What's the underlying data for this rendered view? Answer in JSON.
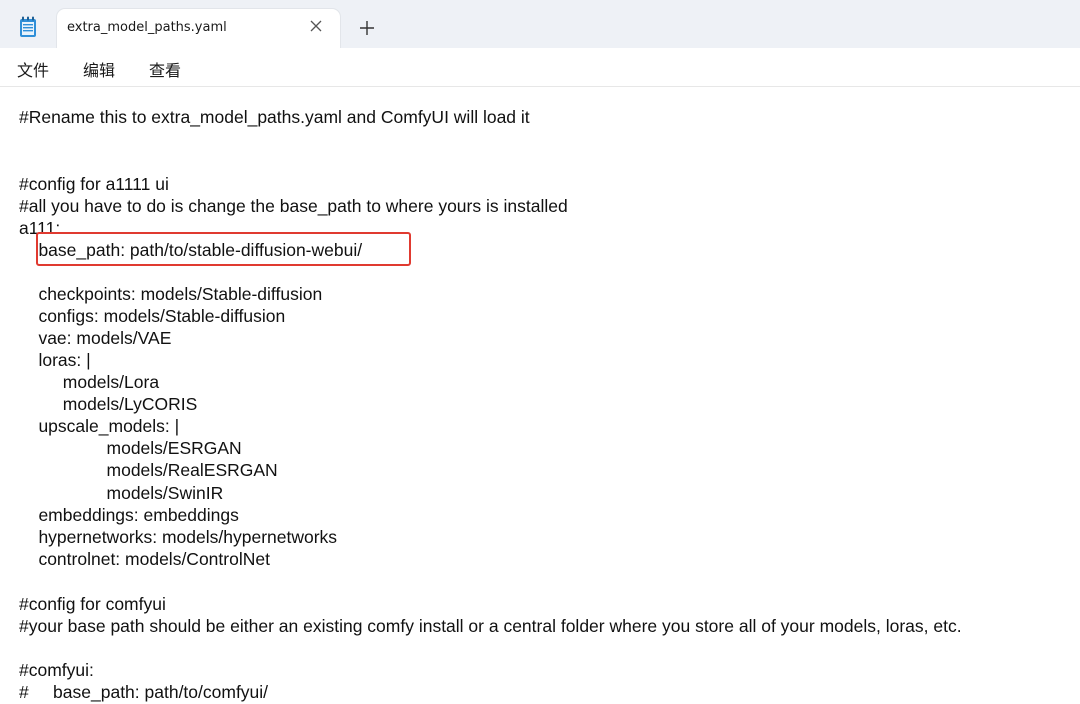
{
  "tab": {
    "title": "extra_model_paths.yaml",
    "close_icon": "close-icon",
    "add_icon": "plus-icon"
  },
  "app_icon": "notepad-icon",
  "menu": {
    "file": "文件",
    "edit": "编辑",
    "view": "查看"
  },
  "editor": {
    "lines": [
      "#Rename this to extra_model_paths.yaml and ComfyUI will load it",
      "",
      "",
      "#config for a1111 ui",
      "#all you have to do is change the base_path to where yours is installed",
      "a111:",
      "    base_path: path/to/stable-diffusion-webui/",
      "",
      "    checkpoints: models/Stable-diffusion",
      "    configs: models/Stable-diffusion",
      "    vae: models/VAE",
      "    loras: |",
      "         models/Lora",
      "         models/LyCORIS",
      "    upscale_models: |",
      "                  models/ESRGAN",
      "                  models/RealESRGAN",
      "                  models/SwinIR",
      "    embeddings: embeddings",
      "    hypernetworks: models/hypernetworks",
      "    controlnet: models/ControlNet",
      "",
      "#config for comfyui",
      "#your base path should be either an existing comfy install or a central folder where you store all of your models, loras, etc.",
      "",
      "#comfyui:",
      "#     base_path: path/to/comfyui/"
    ],
    "highlight_color": "#e03a30"
  }
}
